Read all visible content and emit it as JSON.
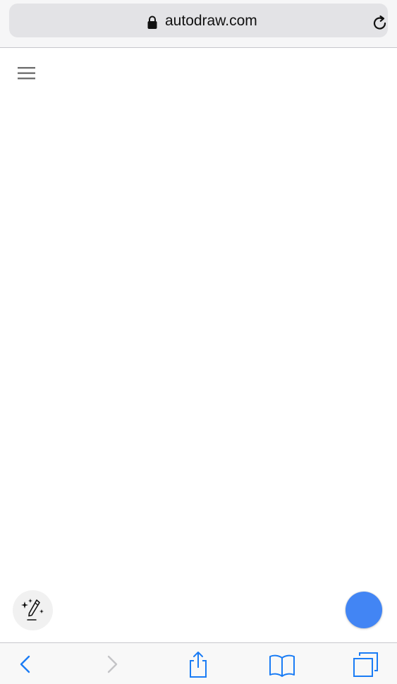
{
  "browser": {
    "url": "autodraw.com",
    "icons": {
      "lock": "lock-icon",
      "reload": "reload-icon"
    }
  },
  "page": {
    "menu_icon": "hamburger-menu-icon",
    "autodraw_tool_icon": "autodraw-sparkle-pen-icon",
    "color_picker": {
      "selected_color": "#4285f4"
    }
  },
  "toolbar": {
    "back_icon": "chevron-left-icon",
    "forward_icon": "chevron-right-icon",
    "share_icon": "share-icon",
    "bookmarks_icon": "book-icon",
    "tabs_icon": "tabs-icon",
    "accent_color": "#1a7cf5",
    "disabled_color": "#c4c4c7"
  }
}
